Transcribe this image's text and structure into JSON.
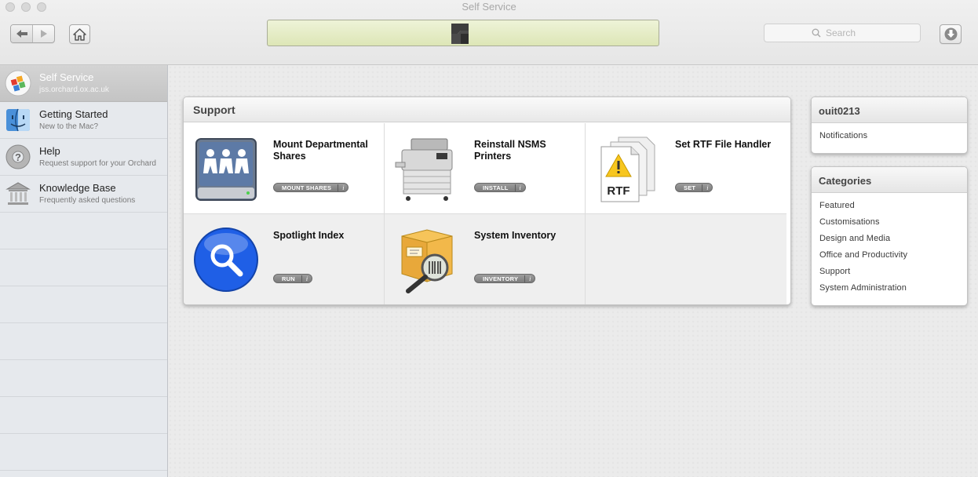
{
  "window": {
    "title": "Self Service"
  },
  "toolbar": {
    "back_icon": "back-arrow-icon",
    "forward_icon": "forward-arrow-icon",
    "home_icon": "home-icon",
    "search_placeholder": "Search",
    "download_icon": "download-arrow-icon"
  },
  "sidebar": {
    "items": [
      {
        "title": "Self Service",
        "subtitle": "jss.orchard.ox.ac.uk",
        "icon": "self-service-logo-icon",
        "selected": true
      },
      {
        "title": "Getting Started",
        "subtitle": "New to the Mac?",
        "icon": "finder-icon",
        "selected": false
      },
      {
        "title": "Help",
        "subtitle": "Request support for your Orchard",
        "icon": "lifebuoy-icon",
        "selected": false
      },
      {
        "title": "Knowledge Base",
        "subtitle": "Frequently asked questions",
        "icon": "library-icon",
        "selected": false
      }
    ]
  },
  "support": {
    "title": "Support",
    "items": [
      {
        "title": "Mount Departmental Shares",
        "button": "MOUNT SHARES",
        "icon": "network-drive-icon"
      },
      {
        "title": "Reinstall NSMS Printers",
        "button": "INSTALL",
        "icon": "printer-icon"
      },
      {
        "title": "Set RTF File Handler",
        "button": "SET",
        "icon": "rtf-document-icon"
      },
      {
        "title": "Spotlight Index",
        "button": "RUN",
        "icon": "spotlight-icon"
      },
      {
        "title": "System Inventory",
        "button": "INVENTORY",
        "icon": "inventory-box-icon"
      }
    ],
    "info_label": "i"
  },
  "user": {
    "name": "ouit0213",
    "notifications": "Notifications"
  },
  "categories": {
    "title": "Categories",
    "items": [
      "Featured",
      "Customisations",
      "Design and Media",
      "Office and Productivity",
      "Support",
      "System Administration"
    ]
  },
  "colors": {
    "progress_fill": "#dde6b6",
    "sidebar_bg": "#e6e9ed",
    "button_gray": "#8a8a8a"
  }
}
